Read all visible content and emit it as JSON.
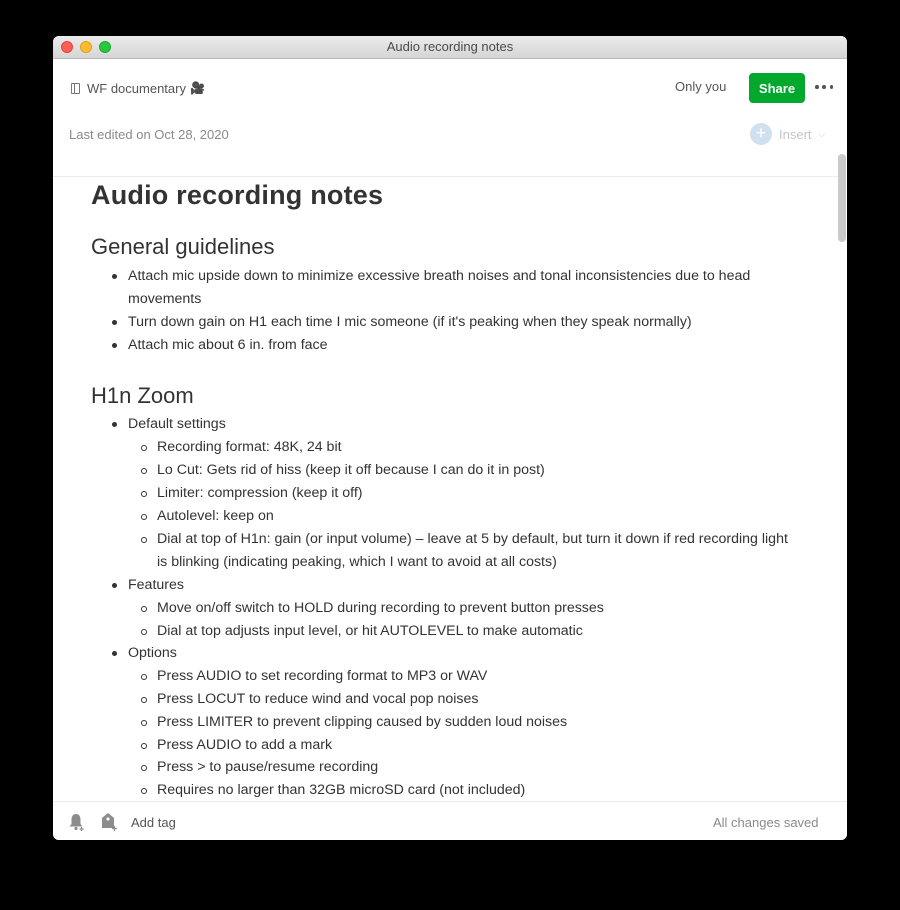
{
  "window": {
    "title": "Audio recording notes"
  },
  "header": {
    "notebook_name": "WF documentary",
    "notebook_emoji": "🎥",
    "visibility": "Only you",
    "share_label": "Share",
    "last_edited": "Last edited on Oct 28, 2020",
    "insert_label": "Insert"
  },
  "note": {
    "title": "Audio recording notes",
    "sections": [
      {
        "heading": "General guidelines",
        "items": [
          "Attach mic upside down to minimize excessive breath noises and tonal inconsistencies due to head",
          "movements",
          "Turn down gain on H1 each time I mic someone (if it's peaking when they speak normally)",
          "Attach mic about 6 in. from face"
        ]
      },
      {
        "heading": "H1n Zoom",
        "groups": [
          {
            "label": "Default settings",
            "items": [
              "Recording format: 48K, 24 bit",
              "Lo Cut: Gets rid of hiss (keep it off because I can do it in post)",
              "Limiter: compression (keep it off)",
              "Autolevel: keep on",
              "Dial at top of H1n: gain (or input volume) – leave at 5 by default, but turn it down if red recording light",
              "is blinking (indicating peaking, which I want to avoid at all costs)"
            ]
          },
          {
            "label": "Features",
            "items": [
              "Move on/off switch to HOLD during recording to prevent button presses",
              "Dial at top adjusts input level, or hit AUTOLEVEL to make automatic"
            ]
          },
          {
            "label": "Options",
            "items": [
              "Press AUDIO to set recording format to MP3 or WAV",
              "Press LOCUT to reduce wind and vocal pop noises",
              "Press LIMITER to prevent clipping caused by sudden loud noises",
              "Press AUDIO to add a mark",
              "Press > to pause/resume recording",
              "Requires no larger than 32GB microSD card (not included)"
            ]
          }
        ]
      }
    ]
  },
  "footer": {
    "add_tag": "Add tag",
    "status": "All changes saved"
  },
  "colors": {
    "share_green": "#00a82d",
    "text": "#333333",
    "muted": "#8a8a8a"
  }
}
